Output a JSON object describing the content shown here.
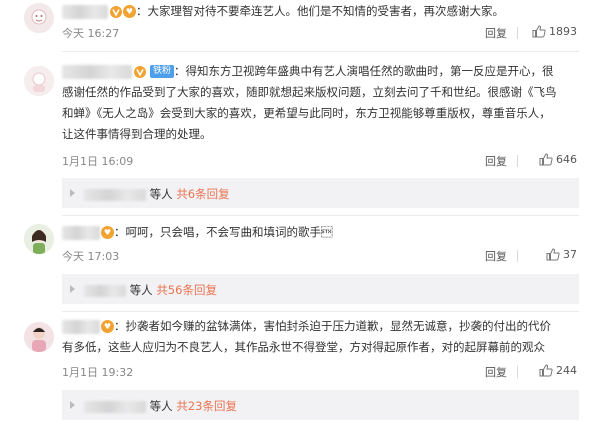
{
  "comments": [
    {
      "text_suffix": "：大家理智对待不要牵连艺人。他们是不知情的受害者，再次感谢大家。",
      "time": "今天 16:27",
      "reply_label": "回复",
      "likes": "1893"
    },
    {
      "fan_badge": "铁粉",
      "lines": [
        "：得知东方卫视跨年盛典中有艺人演唱任然的歌曲时，第一反应是开心，很",
        "感谢任然的作品受到了大家的喜欢，随即就想起来版权问题，立刻去问了千和世纪。很感谢《飞鸟",
        "和蝉》《无人之岛》会受到大家的喜欢，更希望与此同时，东方卫视能够尊重版权，尊重音乐人，",
        "让这件事情得到合理的处理。"
      ],
      "time": "1月1日 16:09",
      "reply_label": "回复",
      "likes": "646",
      "subreplies": {
        "prefix": "等人",
        "link": "共6条回复"
      }
    },
    {
      "text_suffix": "：呵呵，只会唱，不会写曲和填词的歌手\u0002",
      "time": "今天 17:03",
      "reply_label": "回复",
      "likes": "37",
      "subreplies": {
        "prefix": "等人",
        "link": "共56条回复"
      }
    },
    {
      "lines": [
        "：抄袭者如今赚的盆钵满体，害怕封杀迫于压力道歉，显然无诚意，抄袭的付出的代价",
        "有多低，这些人应归为不良艺人，其作品永世不得登堂，方对得起原作者，对的起屏幕前的观众"
      ],
      "time": "1月1日 19:32",
      "reply_label": "回复",
      "likes": "244",
      "subreplies": {
        "prefix": "等人",
        "link": "共23条回复"
      }
    }
  ],
  "colors": {
    "link": "#eb7350",
    "tiefen_badge": "#4e9fea",
    "fan_badge": "#f2a230",
    "subbox_bg": "#f2f2f5"
  },
  "icons": {
    "like": "thumbs-up-icon",
    "verified": "v-badge-icon",
    "fan": "fan-badge-icon"
  }
}
